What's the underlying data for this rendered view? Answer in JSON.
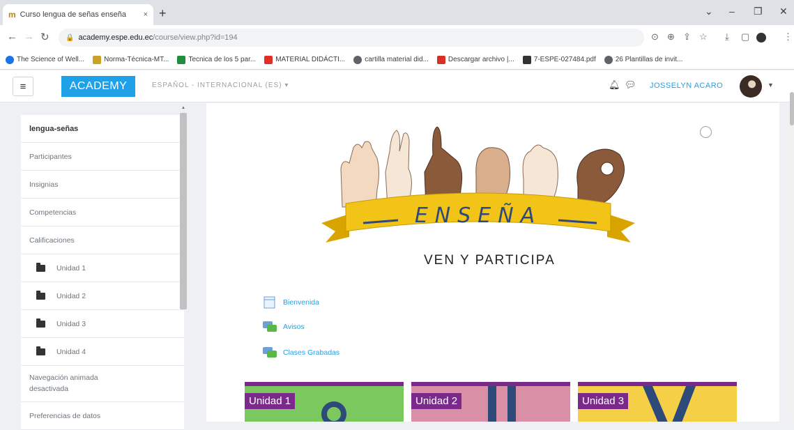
{
  "browser": {
    "tab_title": "Curso lengua de señas enseña",
    "tab_close": "×",
    "new_tab": "+",
    "url_host": "academy.espe.edu.ec",
    "url_path": "/course/view.php?id=194",
    "bookmarks": [
      {
        "label": "The Science of Well...",
        "icon": "globe-icon",
        "color": "#1a73e8"
      },
      {
        "label": "Norma-Técnica-MT...",
        "icon": "shield-icon",
        "color": "#c9a227"
      },
      {
        "label": "Tecnica de los 5 par...",
        "icon": "bookmark-icon",
        "color": "#1e8e3e"
      },
      {
        "label": "MATERIAL DIDÁCTI...",
        "icon": "youtube-icon",
        "color": "#e52d27"
      },
      {
        "label": "cartilla material did...",
        "icon": "globe-icon",
        "color": "#5f6368"
      },
      {
        "label": "Descargar archivo |...",
        "icon": "download-icon",
        "color": "#d93025"
      },
      {
        "label": "7-ESPE-027484.pdf",
        "icon": "pdf-icon",
        "color": "#333333"
      },
      {
        "label": "26 Plantillas de invit...",
        "icon": "globe-icon",
        "color": "#5f6368"
      }
    ]
  },
  "navbar": {
    "menu_icon": "≡",
    "brand": "ACADEMY",
    "language": "ESPAÑOL - INTERNACIONAL (ES) ▾",
    "user_name": "JOSSELYN ACARO",
    "accent": "#1ea1e8"
  },
  "drawer": {
    "items": [
      {
        "label": "lengua-señas",
        "bold": true,
        "folder": false
      },
      {
        "label": "Participantes",
        "bold": false,
        "folder": false
      },
      {
        "label": "Insignias",
        "bold": false,
        "folder": false
      },
      {
        "label": "Competencias",
        "bold": false,
        "folder": false
      },
      {
        "label": "Calificaciones",
        "bold": false,
        "folder": false
      },
      {
        "label": "Unidad 1",
        "bold": false,
        "folder": true
      },
      {
        "label": "Unidad 2",
        "bold": false,
        "folder": true
      },
      {
        "label": "Unidad 3",
        "bold": false,
        "folder": true
      },
      {
        "label": "Unidad 4",
        "bold": false,
        "folder": true
      },
      {
        "label": "Navegación animada desactivada",
        "bold": false,
        "folder": false
      },
      {
        "label": "Preferencias de datos",
        "bold": false,
        "folder": false
      }
    ]
  },
  "banner": {
    "word": "ENSEÑA",
    "tagline": "VEN Y PARTICIPA"
  },
  "activities": [
    {
      "label": "Bienvenida",
      "icon": "page-icon"
    },
    {
      "label": "Avisos",
      "icon": "forum-icon"
    },
    {
      "label": "Clases Grabadas",
      "icon": "forum-icon"
    }
  ],
  "units": [
    {
      "label": "Unidad 1",
      "bg": "#7ac85e"
    },
    {
      "label": "Unidad 2",
      "bg": "#d98fa5"
    },
    {
      "label": "Unidad 3",
      "bg": "#f5d046"
    }
  ]
}
